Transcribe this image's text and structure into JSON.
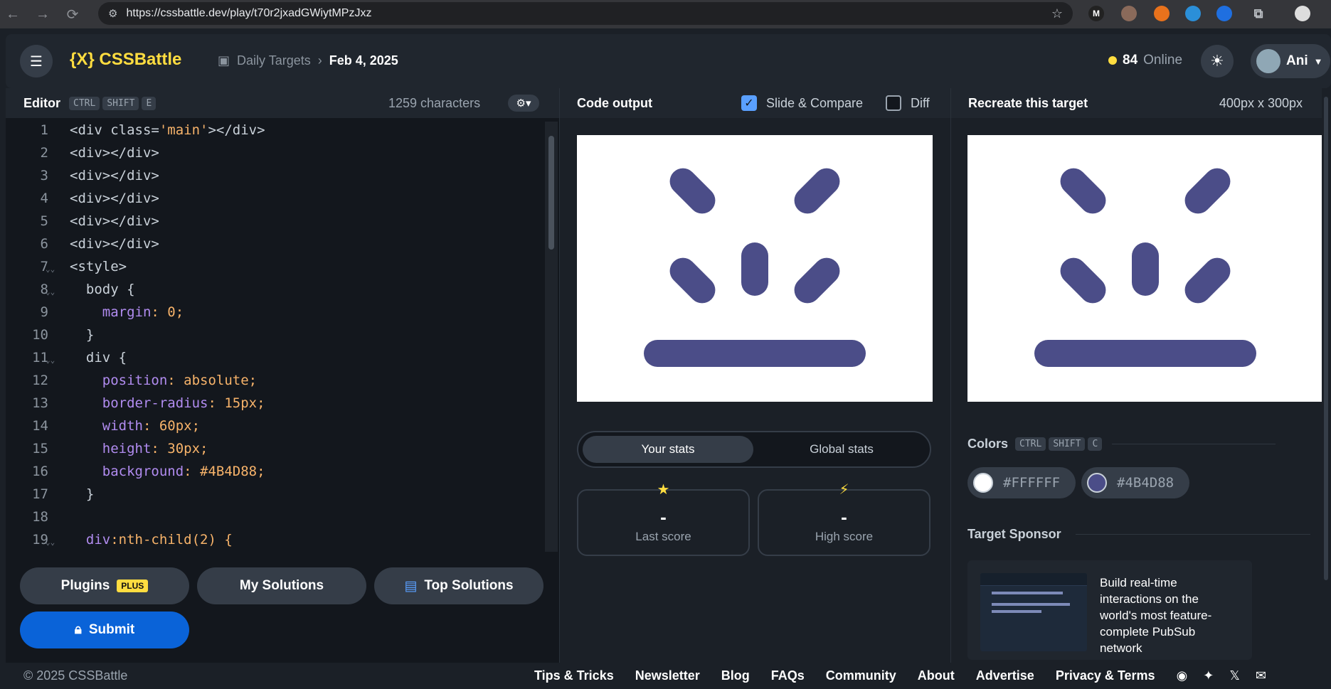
{
  "browser": {
    "url": "https://cssbattle.dev/play/t70r2jxadGWiytMPzJxz",
    "back_icon": "←",
    "forward_icon": "→",
    "reload_icon": "⟳",
    "star_icon": "☆"
  },
  "header": {
    "logo": "{X} CSSBattle",
    "crumb_section": "Daily Targets",
    "crumb_separator": "›",
    "crumb_date": "Feb 4, 2025",
    "online_count": "84",
    "online_label": "Online",
    "user_name": "Ani",
    "accent_color": "#FFDD40"
  },
  "editor": {
    "title": "Editor",
    "shortcut": [
      "CTRL",
      "SHIFT",
      "E"
    ],
    "char_count": "1259 characters",
    "lines": [
      {
        "n": "1",
        "text": "<div class='main'></div>"
      },
      {
        "n": "2",
        "text": "<div></div>"
      },
      {
        "n": "3",
        "text": "<div></div>"
      },
      {
        "n": "4",
        "text": "<div></div>"
      },
      {
        "n": "5",
        "text": "<div></div>"
      },
      {
        "n": "6",
        "text": "<div></div>"
      },
      {
        "n": "7",
        "text": "<style>",
        "fold": true
      },
      {
        "n": "8",
        "text": "  body {",
        "fold": true
      },
      {
        "n": "9",
        "text": "    margin: 0;"
      },
      {
        "n": "10",
        "text": "  }"
      },
      {
        "n": "11",
        "text": "  div {",
        "fold": true
      },
      {
        "n": "12",
        "text": "    position: absolute;"
      },
      {
        "n": "13",
        "text": "    border-radius: 15px;"
      },
      {
        "n": "14",
        "text": "    width: 60px;"
      },
      {
        "n": "15",
        "text": "    height: 30px;"
      },
      {
        "n": "16",
        "text": "    background: #4B4D88;"
      },
      {
        "n": "17",
        "text": "  }"
      },
      {
        "n": "18",
        "text": ""
      },
      {
        "n": "19",
        "text": "  div:nth-child(2) {",
        "fold": true
      }
    ]
  },
  "actions": {
    "plugins": "Plugins",
    "plugins_badge": "PLUS",
    "my_solutions": "My Solutions",
    "top_solutions": "Top Solutions",
    "submit": "Submit"
  },
  "output": {
    "title": "Code output",
    "slide_compare": "Slide & Compare",
    "slide_checked": true,
    "diff": "Diff",
    "diff_checked": false
  },
  "stats": {
    "your_stats": "Your stats",
    "global_stats": "Global stats",
    "last_score_value": "-",
    "last_score_label": "Last score",
    "high_score_value": "-",
    "high_score_label": "High score"
  },
  "target": {
    "title": "Recreate this target",
    "size": "400px x 300px",
    "colors_label": "Colors",
    "colors_shortcut": [
      "CTRL",
      "SHIFT",
      "C"
    ],
    "colors": [
      {
        "hex": "#FFFFFF"
      },
      {
        "hex": "#4B4D88"
      }
    ],
    "sponsor_title": "Target Sponsor",
    "sponsor_text": "Build real-time interactions on the world's most feature-complete PubSub network"
  },
  "footer": {
    "copyright": "© 2025 CSSBattle",
    "links": [
      "Tips & Tricks",
      "Newsletter",
      "Blog",
      "FAQs",
      "Community",
      "About",
      "Advertise",
      "Privacy & Terms"
    ]
  }
}
